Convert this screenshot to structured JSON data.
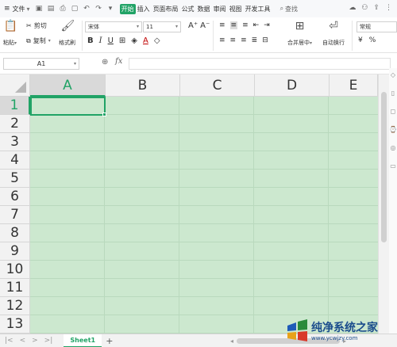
{
  "menu": {
    "file_label": "文件",
    "tabs": [
      "开始",
      "插入",
      "页面布局",
      "公式",
      "数据",
      "审阅",
      "视图",
      "开发工具"
    ],
    "active_tab": "开始",
    "search_label": "查找"
  },
  "ribbon": {
    "paste_label": "粘贴",
    "cut_label": "剪切",
    "copy_label": "复制",
    "format_painter_label": "格式刷",
    "font_name": "宋体",
    "font_size": "11",
    "grow_font": "A⁺",
    "shrink_font": "A⁻",
    "merge_label": "合并居中",
    "wrap_label": "自动换行",
    "number_format": "常规",
    "currency_symbol": "¥",
    "percent_symbol": "%"
  },
  "formula_bar": {
    "name_box": "A1",
    "fx_label": "fx",
    "formula": ""
  },
  "grid": {
    "columns": [
      "A",
      "B",
      "C",
      "D",
      "E"
    ],
    "rows": [
      "1",
      "2",
      "3",
      "4",
      "5",
      "6",
      "7",
      "8",
      "9",
      "10",
      "11",
      "12",
      "13"
    ],
    "selected_cell": "A1",
    "cell_fill_color": "#cce8cf"
  },
  "sheets": {
    "tabs": [
      "Sheet1"
    ],
    "active": "Sheet1",
    "add_label": "+"
  },
  "watermark": {
    "title": "纯净系统之家",
    "url": "www.ycwjzy.com"
  },
  "colors": {
    "accent": "#21a366",
    "header_bg": "#f2f2f2"
  }
}
